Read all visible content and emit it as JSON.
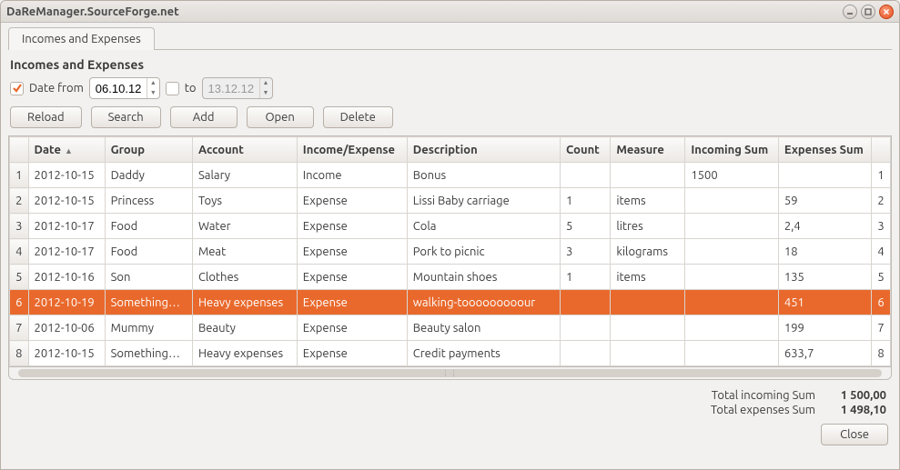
{
  "window": {
    "title": "DaReManager.SourceForge.net"
  },
  "tab": {
    "label": "Incomes and Expenses"
  },
  "section": {
    "title": "Incomes and Expenses"
  },
  "filter": {
    "from_label": "Date from",
    "from_value": "06.10.12",
    "to_label": "to",
    "to_value": "13.12.12"
  },
  "toolbar": {
    "reload": "Reload",
    "search": "Search",
    "add": "Add",
    "open": "Open",
    "delete": "Delete"
  },
  "columns": [
    "Date",
    "Group",
    "Account",
    "Income/Expense",
    "Description",
    "Count",
    "Measure",
    "Incoming Sum",
    "Expenses Sum"
  ],
  "rows": [
    {
      "n": "1",
      "date": "2012-10-15",
      "group": "Daddy",
      "account": "Salary",
      "type": "Income",
      "desc": "Bonus",
      "count": "",
      "measure": "",
      "inc": "1500",
      "exp": "",
      "last": "1"
    },
    {
      "n": "2",
      "date": "2012-10-15",
      "group": "Princess",
      "account": "Toys",
      "type": "Expense",
      "desc": "Lissi Baby carriage",
      "count": "1",
      "measure": "items",
      "inc": "",
      "exp": "59",
      "last": "2"
    },
    {
      "n": "3",
      "date": "2012-10-17",
      "group": "Food",
      "account": "Water",
      "type": "Expense",
      "desc": "Cola",
      "count": "5",
      "measure": "litres",
      "inc": "",
      "exp": "2,4",
      "last": "3"
    },
    {
      "n": "4",
      "date": "2012-10-17",
      "group": "Food",
      "account": "Meat",
      "type": "Expense",
      "desc": "Pork to picnic",
      "count": "3",
      "measure": "kilograms",
      "inc": "",
      "exp": "18",
      "last": "4"
    },
    {
      "n": "5",
      "date": "2012-10-16",
      "group": "Son",
      "account": "Clothes",
      "type": "Expense",
      "desc": "Mountain shoes",
      "count": "1",
      "measure": "items",
      "inc": "",
      "exp": "135",
      "last": "5"
    },
    {
      "n": "6",
      "date": "2012-10-19",
      "group": "Something…",
      "account": "Heavy expenses",
      "type": "Expense",
      "desc": "walking-tooooooooour",
      "count": "",
      "measure": "",
      "inc": "",
      "exp": "451",
      "last": "6",
      "selected": true
    },
    {
      "n": "7",
      "date": "2012-10-06",
      "group": "Mummy",
      "account": "Beauty",
      "type": "Expense",
      "desc": "Beauty salon",
      "count": "",
      "measure": "",
      "inc": "",
      "exp": "199",
      "last": "7"
    },
    {
      "n": "8",
      "date": "2012-10-15",
      "group": "Something…",
      "account": "Heavy expenses",
      "type": "Expense",
      "desc": "Credit payments",
      "count": "",
      "measure": "",
      "inc": "",
      "exp": "633,7",
      "last": "8"
    }
  ],
  "totals": {
    "incoming_label": "Total incoming Sum",
    "incoming_value": "1 500,00",
    "expenses_label": "Total expenses Sum",
    "expenses_value": "1 498,10"
  },
  "footer": {
    "close": "Close"
  }
}
